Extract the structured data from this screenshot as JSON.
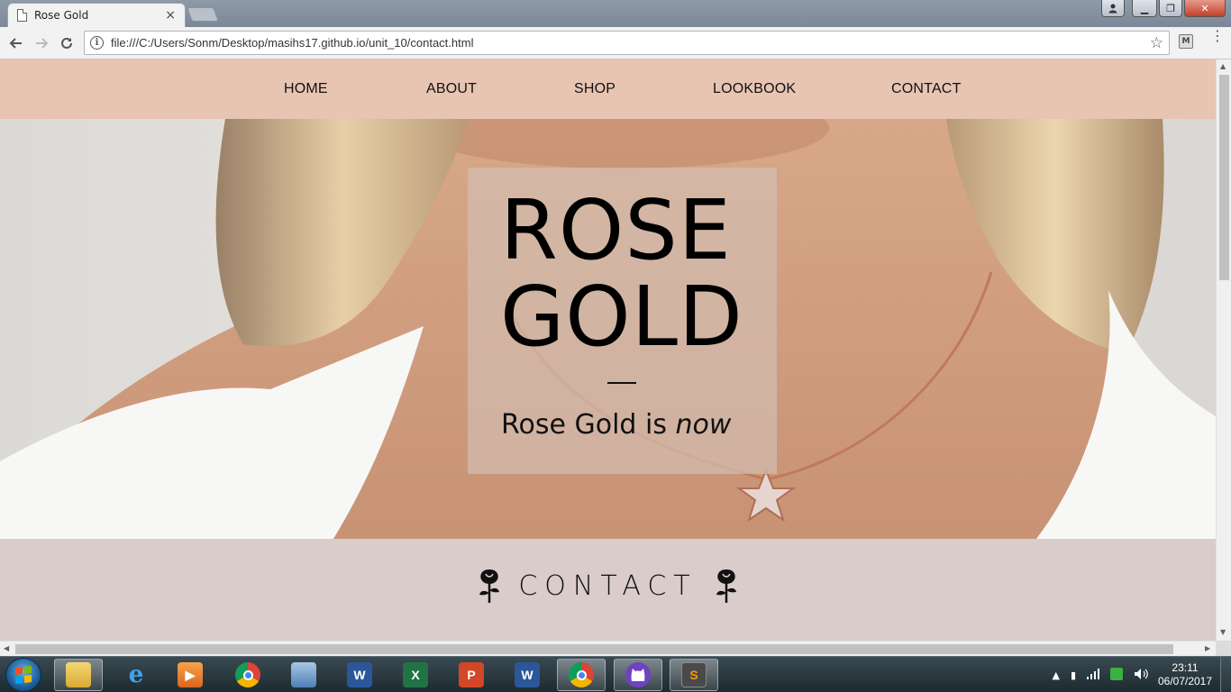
{
  "browser": {
    "tab_title": "Rose Gold",
    "tab_close": "×",
    "url": "file:///C:/Users/Sonm/Desktop/masihs17.github.io/unit_10/contact.html",
    "back_icon": "arrow-left",
    "forward_icon": "arrow-right",
    "reload_icon": "reload",
    "window_controls": {
      "minimize": "▁",
      "maximize": "❐",
      "close": "✕"
    }
  },
  "nav": {
    "items": [
      {
        "label": "HOME"
      },
      {
        "label": "ABOUT"
      },
      {
        "label": "SHOP"
      },
      {
        "label": "LOOKBOOK"
      },
      {
        "label": "CONTACT"
      }
    ],
    "background": "#e8c4b2"
  },
  "hero": {
    "title_line1": "ROSE",
    "title_line2": "GOLD",
    "tagline_prefix": "Rose Gold is ",
    "tagline_emphasis": "now"
  },
  "contact": {
    "heading": "CONTACT",
    "band_color": "#d9cccb",
    "icon": "rose-icon"
  },
  "taskbar": {
    "apps": [
      {
        "name": "file-explorer"
      },
      {
        "name": "internet-explorer"
      },
      {
        "name": "media-player"
      },
      {
        "name": "chrome"
      },
      {
        "name": "photo-viewer"
      },
      {
        "name": "word"
      },
      {
        "name": "excel"
      },
      {
        "name": "powerpoint"
      },
      {
        "name": "word-2"
      },
      {
        "name": "chrome-active"
      },
      {
        "name": "github-desktop"
      },
      {
        "name": "sublime-text"
      }
    ],
    "clock_time": "23:11",
    "clock_date": "06/07/2017"
  }
}
